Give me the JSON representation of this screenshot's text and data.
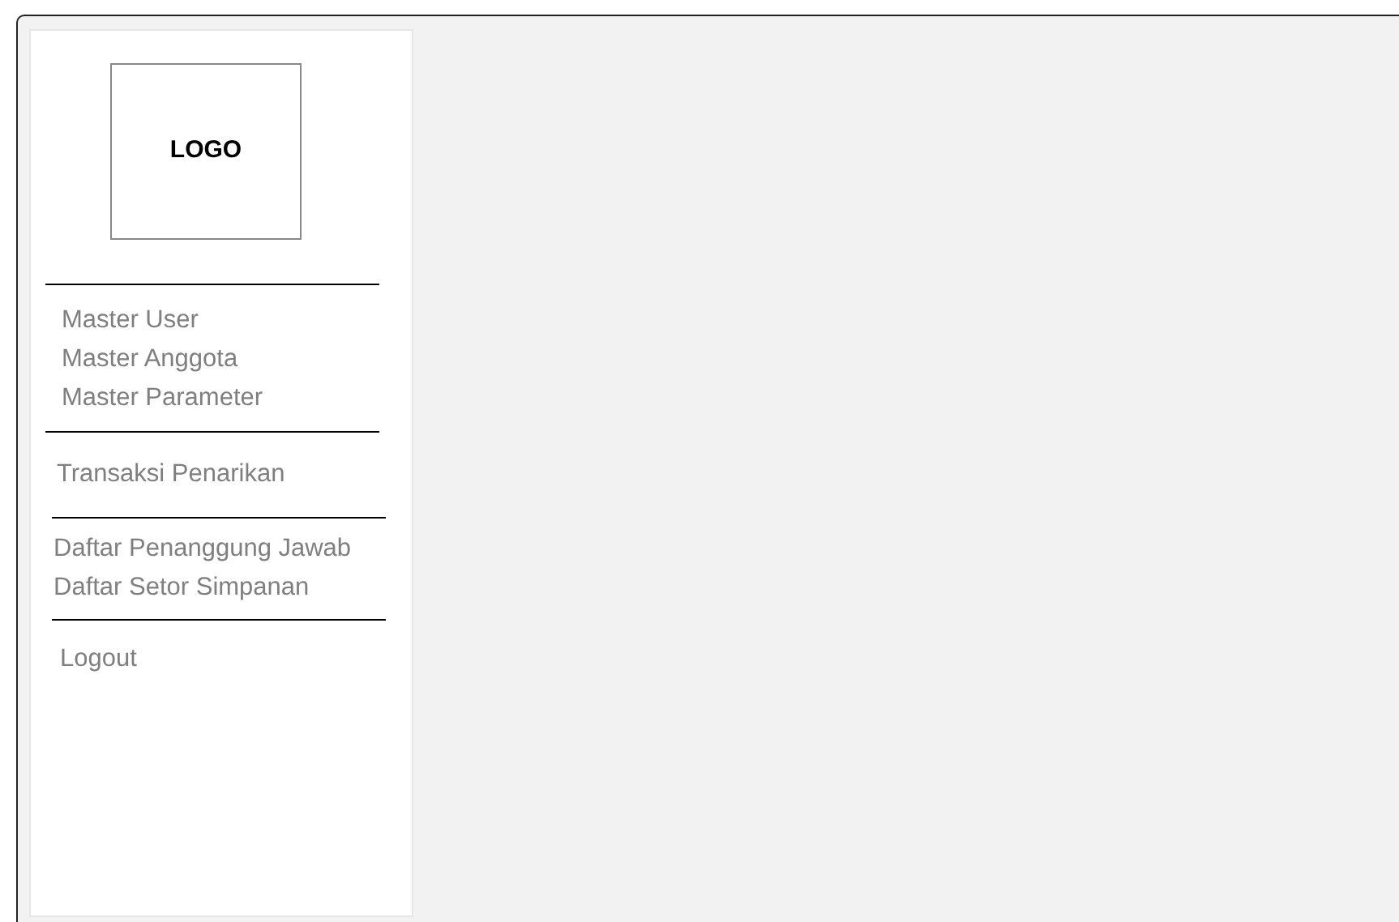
{
  "logo": {
    "text": "LOGO"
  },
  "menu_groups": [
    {
      "items": [
        "Master User",
        "Master Anggota",
        "Master Parameter"
      ]
    },
    {
      "items": [
        "Transaksi Penarikan"
      ]
    },
    {
      "items": [
        "Daftar Penanggung Jawab",
        "Daftar Setor Simpanan"
      ]
    },
    {
      "items": [
        "Logout"
      ]
    }
  ]
}
